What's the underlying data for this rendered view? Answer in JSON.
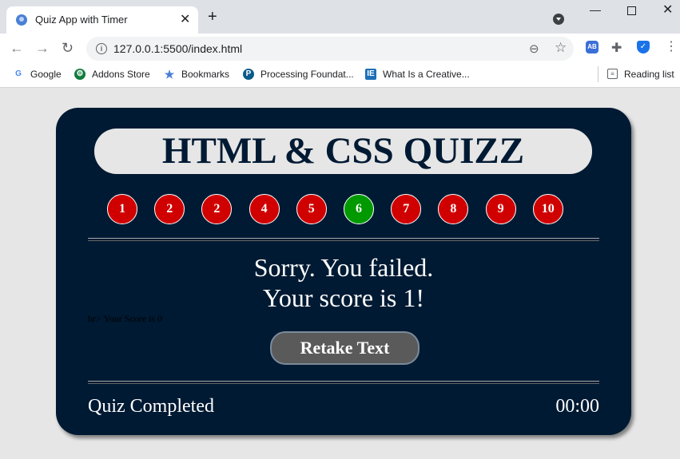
{
  "browser": {
    "tab_title": "Quiz App with Timer",
    "url": "127.0.0.1:5500/index.html",
    "ext_ab_label": "AB",
    "bookmarks": [
      {
        "label": "Google"
      },
      {
        "label": "Addons Store"
      },
      {
        "label": "Bookmarks"
      },
      {
        "label": "Processing Foundat..."
      },
      {
        "label": "What Is a Creative..."
      }
    ],
    "reading_list": "Reading list"
  },
  "quiz": {
    "title": "HTML & CSS QUIZZ",
    "question_numbers": [
      {
        "label": "1",
        "status": "wrong",
        "color": "#d00000"
      },
      {
        "label": "2",
        "status": "wrong",
        "color": "#d00000"
      },
      {
        "label": "2",
        "status": "wrong",
        "color": "#d00000"
      },
      {
        "label": "4",
        "status": "wrong",
        "color": "#d00000"
      },
      {
        "label": "5",
        "status": "wrong",
        "color": "#d00000"
      },
      {
        "label": "6",
        "status": "correct",
        "color": "#009900"
      },
      {
        "label": "7",
        "status": "wrong",
        "color": "#d00000"
      },
      {
        "label": "8",
        "status": "wrong",
        "color": "#d00000"
      },
      {
        "label": "9",
        "status": "wrong",
        "color": "#d00000"
      },
      {
        "label": "10",
        "status": "wrong",
        "color": "#d00000"
      }
    ],
    "result_line1": "Sorry. You failed.",
    "result_line2": "Your score is 1!",
    "stray_text": "br> Your Score is 0",
    "retake_label": "Retake Text",
    "status": "Quiz Completed",
    "timer": "00:00"
  },
  "colors": {
    "card_bg": "#001a33",
    "page_bg": "#e6e6e6",
    "wrong": "#d00000",
    "correct": "#009900"
  }
}
